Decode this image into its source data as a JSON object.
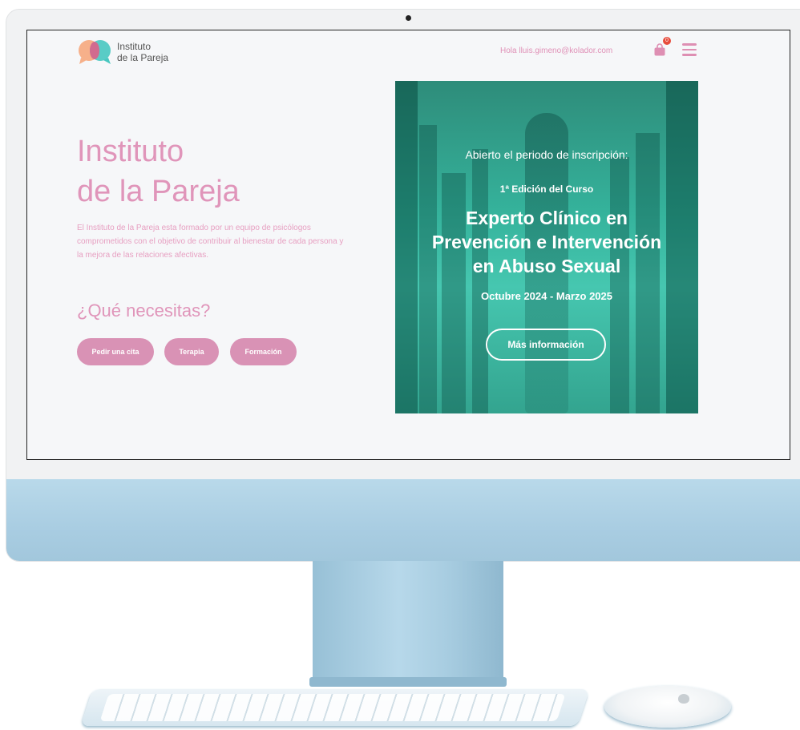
{
  "header": {
    "logo_line1": "Instituto",
    "logo_line2": "de la Pareja",
    "greeting": "Hola lluis.gimeno@kolador.com",
    "cart_count": "0"
  },
  "hero": {
    "title_line1": "Instituto",
    "title_line2": "de la Pareja",
    "description": "El Instituto de la Pareja esta formado por un equipo de psicólogos comprometidos con el objetivo de contribuir al bienestar de cada persona y la mejora de las relaciones afectivas.",
    "needs_title": "¿Qué necesitas?",
    "buttons": [
      "Pedir una cita",
      "Terapia",
      "Formación"
    ]
  },
  "banner": {
    "open_text": "Abierto el periodo de inscripción:",
    "edition": "1ª Edición del Curso",
    "course_line1": "Experto Clínico en",
    "course_line2": "Prevención e Intervención",
    "course_line3": "en Abuso Sexual",
    "dates": "Octubre 2024 - Marzo 2025",
    "more_button": "Más información"
  },
  "icons": {
    "logo": "speech-bubbles-logo-icon",
    "cart": "shopping-bag-icon",
    "menu": "hamburger-menu-icon",
    "apple": "apple-logo-icon"
  },
  "colors": {
    "brand_pink": "#e095ba",
    "button_pink": "#d992b5",
    "banner_teal": "#35b39c",
    "logo_orange": "#f6b08a",
    "logo_teal": "#48c7c0"
  }
}
